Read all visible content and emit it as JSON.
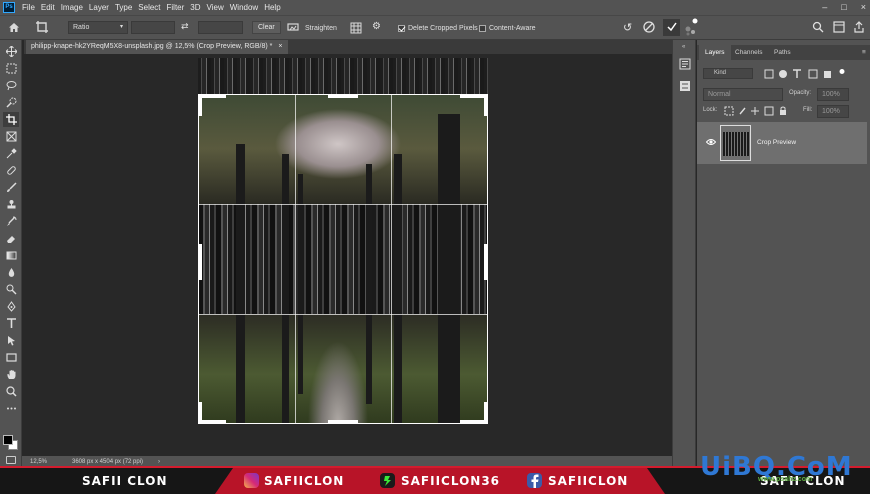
{
  "app": {
    "logo_text": "Ps"
  },
  "menu": [
    "File",
    "Edit",
    "Image",
    "Layer",
    "Type",
    "Select",
    "Filter",
    "3D",
    "View",
    "Window",
    "Help"
  ],
  "window_controls": [
    "–",
    "□",
    "×"
  ],
  "options_bar": {
    "ratio_label": "Ratio",
    "clear_label": "Clear",
    "straighten_label": "Straighten",
    "delete_cropped_label": "Delete Cropped Pixels",
    "delete_cropped_checked": true,
    "content_aware_label": "Content-Aware",
    "content_aware_checked": false
  },
  "document_tab": {
    "title": "philipp-knape-hk2YReqM5X8-unsplash.jpg @ 12,5% (Crop Preview, RGB/8) *",
    "close": "×"
  },
  "status_bar": {
    "zoom": "12,5%",
    "doc_size": "3608 px x 4504 px (72 ppi)",
    "arrow": "›"
  },
  "layers_panel": {
    "tabs": [
      "Layers",
      "Channels",
      "Paths"
    ],
    "active_tab": "Layers",
    "kind_placeholder": "Kind",
    "blend_mode": "Normal",
    "opacity_label": "Opacity:",
    "opacity_value": "100%",
    "lock_label": "Lock:",
    "fill_label": "Fill:",
    "fill_value": "100%",
    "layers": [
      {
        "name": "Crop Preview",
        "visible": true,
        "selected": true
      }
    ]
  },
  "banner": {
    "left_name": "SAFII CLON",
    "instagram": "SAFIICLON",
    "tiktok": "SAFIICLON36",
    "facebook": "SAFIICLON",
    "right_name": "SAFII CLON",
    "accent": "#d31c2e"
  },
  "watermark": {
    "text": "UiBQ.CoM",
    "sub": "www.psahz.com"
  }
}
